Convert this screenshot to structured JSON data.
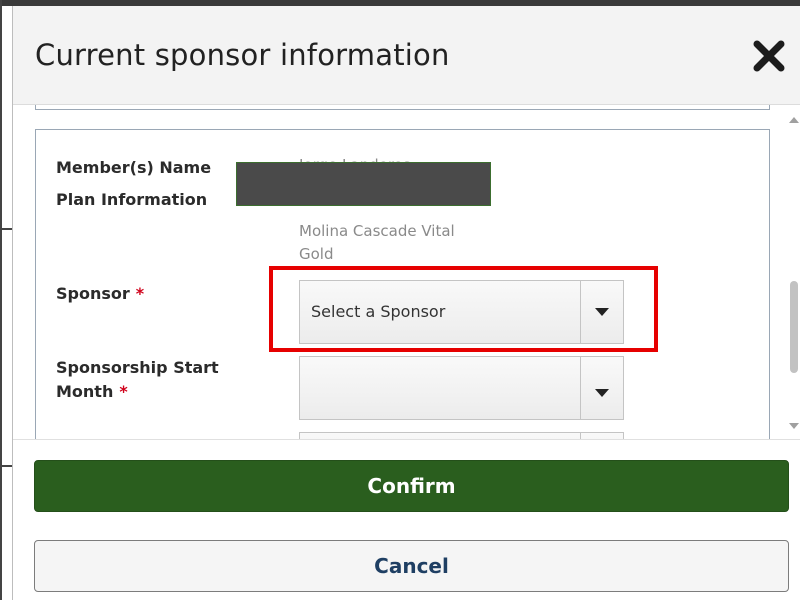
{
  "modal": {
    "title": "Current sponsor information",
    "close_icon": "close-icon"
  },
  "form": {
    "member_label": "Member(s) Name",
    "member_value": "Jorge Landeros",
    "plan_label": "Plan Information",
    "plan_carrier": "Zoe Health",
    "plan_name_line1": "Molina Cascade Vital",
    "plan_name_line2": "Gold",
    "sponsor_label": "Sponsor",
    "sponsor_required": "*",
    "sponsor_selected": "Select a Sponsor",
    "start_month_label_line1": "Sponsorship Start",
    "start_month_label_line2": "Month",
    "start_month_required": "*",
    "start_month_selected": ""
  },
  "footer": {
    "confirm_label": "Confirm",
    "cancel_label": "Cancel"
  },
  "colors": {
    "confirm_bg": "#2a5e1e",
    "cancel_text": "#1f3f63",
    "required": "#d0021b",
    "highlight": "#e60000"
  }
}
